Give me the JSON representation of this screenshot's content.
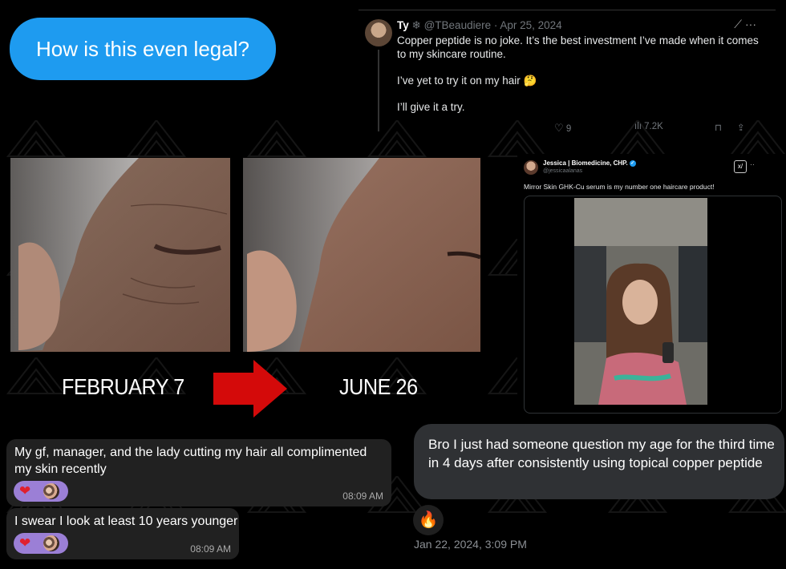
{
  "imessage": {
    "text": "How is this even legal?"
  },
  "tweet1": {
    "name": "Ty",
    "handle": "@TBeaudiere",
    "date": "Apr 25, 2024",
    "paragraphs": [
      "Copper peptide is no joke. It’s the best investment I’ve made when it comes to my skincare routine.",
      "I’ve yet to try it on my hair 🤔",
      "I’ll give it a try."
    ],
    "likes": "9",
    "views": "7.2K"
  },
  "before_after": {
    "before_label": "FEBRUARY 7",
    "after_label": "JUNE 26",
    "arrow_color": "#d40a0a"
  },
  "tweet2": {
    "name": "Jessica | Biomedicine, CHP.",
    "handle": "@jessicaalanas",
    "text": "Mirror Skin GHK-Cu serum is my number one haircare product!"
  },
  "chat_left": [
    {
      "text": "My gf, manager, and the lady cutting my hair all complimented my skin recently",
      "time": "08:09 AM"
    },
    {
      "text": "I swear I look at least 10 years younger",
      "time": "08:09 AM"
    }
  ],
  "chat_right": {
    "text": "Bro I just had someone question my age for the third time in 4 days after consistently using topical copper peptide",
    "reaction": "🔥",
    "date": "Jan 22, 2024, 3:09 PM"
  },
  "colors": {
    "imessage_blue": "#1e9bf0",
    "reaction_purple": "#9b7fd6",
    "bubble_dark": "#212121",
    "bubble_gray": "#2f3134"
  }
}
